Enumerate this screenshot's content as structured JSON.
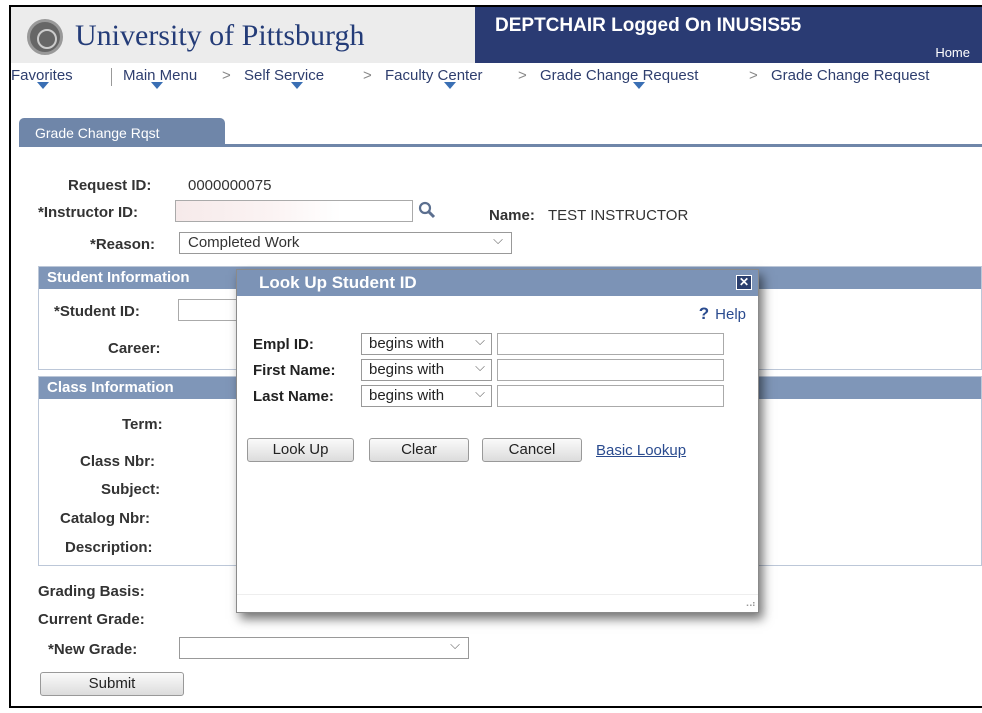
{
  "header": {
    "university": "University of Pittsburgh",
    "logged_on": "DEPTCHAIR Logged On INUSIS55",
    "home": "Home"
  },
  "breadcrumb": {
    "favorites": "Favorites",
    "main_menu": "Main Menu",
    "self_service": "Self Service",
    "faculty_center": "Faculty Center",
    "grade_change_request_1": "Grade Change Request",
    "grade_change_request_2": "Grade Change Request",
    "separator": ">"
  },
  "tab": {
    "label": "Grade Change Rqst"
  },
  "form": {
    "request_id_label": "Request ID:",
    "request_id_value": "0000000075",
    "instructor_id_label": "*Instructor ID:",
    "name_label": "Name:",
    "name_value": "TEST INSTRUCTOR",
    "reason_label": "*Reason:",
    "reason_value": "Completed Work"
  },
  "student_section": {
    "header": "Student Information",
    "student_id_label": "*Student ID:",
    "career_label": "Career:"
  },
  "class_section": {
    "header": "Class Information",
    "term_label": "Term:",
    "class_nbr_label": "Class Nbr:",
    "subject_label": "Subject:",
    "catalog_nbr_label": "Catalog Nbr:",
    "description_label": "Description:"
  },
  "grading": {
    "grading_basis_label": "Grading Basis:",
    "current_grade_label": "Current Grade:",
    "new_grade_label": "*New Grade:",
    "new_grade_value": "",
    "submit_label": "Submit"
  },
  "lookup_modal": {
    "title": "Look Up Student ID",
    "close": "✕",
    "help": "Help",
    "help_icon": "?",
    "rows": [
      {
        "label": "Empl ID:",
        "operator": "begins with",
        "value": ""
      },
      {
        "label": "First Name:",
        "operator": "begins with",
        "value": ""
      },
      {
        "label": "Last Name:",
        "operator": "begins with",
        "value": ""
      }
    ],
    "look_up_label": "Look Up",
    "clear_label": "Clear",
    "cancel_label": "Cancel",
    "basic_lookup_label": "Basic Lookup"
  },
  "colors": {
    "brand_navy": "#2a3b73",
    "section_header": "#7f96b8",
    "link": "#2a4b8f"
  }
}
